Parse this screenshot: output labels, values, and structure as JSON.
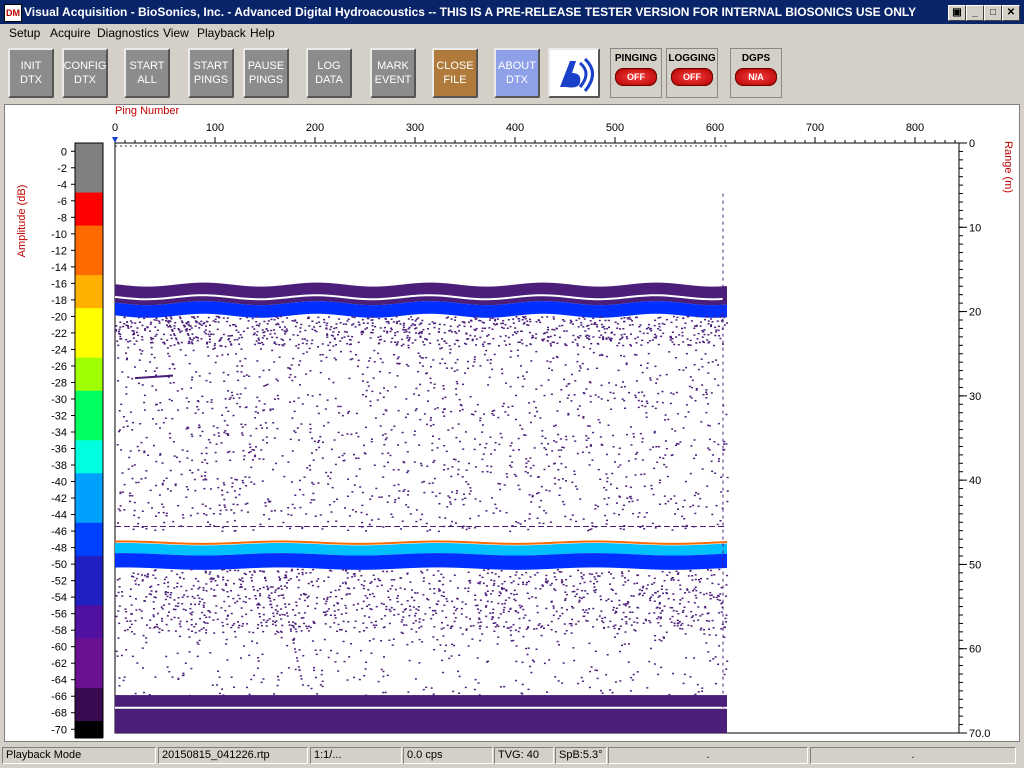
{
  "window": {
    "app_icon_text": "DM",
    "title": "Visual Acquisition  -  BioSonics, Inc.  -  Advanced Digital Hydroacoustics  -- THIS IS A PRE-RELEASE TESTER VERSION FOR INTERNAL BIOSONICS USE ONLY"
  },
  "menu": [
    "Setup",
    "Acquire",
    "Diagnostics",
    "View",
    "Playback",
    "Help"
  ],
  "toolbar": {
    "buttons": [
      {
        "line1": "INIT",
        "line2": "DTX"
      },
      {
        "line1": "CONFIG",
        "line2": "DTX"
      },
      {
        "line1": "START",
        "line2": "ALL"
      },
      {
        "line1": "START",
        "line2": "PINGS"
      },
      {
        "line1": "PAUSE",
        "line2": "PINGS"
      },
      {
        "line1": "LOG",
        "line2": "DATA"
      },
      {
        "line1": "MARK",
        "line2": "EVENT"
      },
      {
        "line1": "CLOSE",
        "line2": "FILE"
      },
      {
        "line1": "ABOUT",
        "line2": "DTX"
      }
    ],
    "indicators": [
      {
        "label": "PINGING",
        "state": "OFF"
      },
      {
        "label": "LOGGING",
        "state": "OFF"
      },
      {
        "label": "DGPS",
        "state": "N/A"
      }
    ]
  },
  "plot": {
    "ping_axis_label": "Ping Number",
    "ping_ticks": [
      "0",
      "100",
      "200",
      "300",
      "400",
      "500",
      "600",
      "700",
      "800"
    ],
    "amplitude_label": "Amplitude (dB)",
    "amplitude_ticks": [
      "0",
      "-2",
      "-4",
      "-6",
      "-8",
      "-10",
      "-12",
      "-14",
      "-16",
      "-18",
      "-20",
      "-22",
      "-24",
      "-26",
      "-28",
      "-30",
      "-32",
      "-34",
      "-36",
      "-38",
      "-40",
      "-42",
      "-44",
      "-46",
      "-48",
      "-50",
      "-52",
      "-54",
      "-56",
      "-58",
      "-60",
      "-62",
      "-64",
      "-66",
      "-68",
      "-70"
    ],
    "range_label": "Range (m)",
    "range_ticks": [
      "0",
      "10",
      "20",
      "30",
      "40",
      "50",
      "60",
      "70.0"
    ],
    "colors": {
      "noise": "#4b1e7a",
      "strong": "#ff6a00",
      "mid": "#00c0ff",
      "blue": "#0030ff"
    }
  },
  "statusbar": {
    "mode": "Playback Mode",
    "file": "20150815_041226.rtp",
    "ratio": "1:1/...",
    "cps": "0.0 cps",
    "tvg": "TVG: 40",
    "spb": "SpB:5.3°",
    "extra1": ".",
    "extra2": "."
  }
}
